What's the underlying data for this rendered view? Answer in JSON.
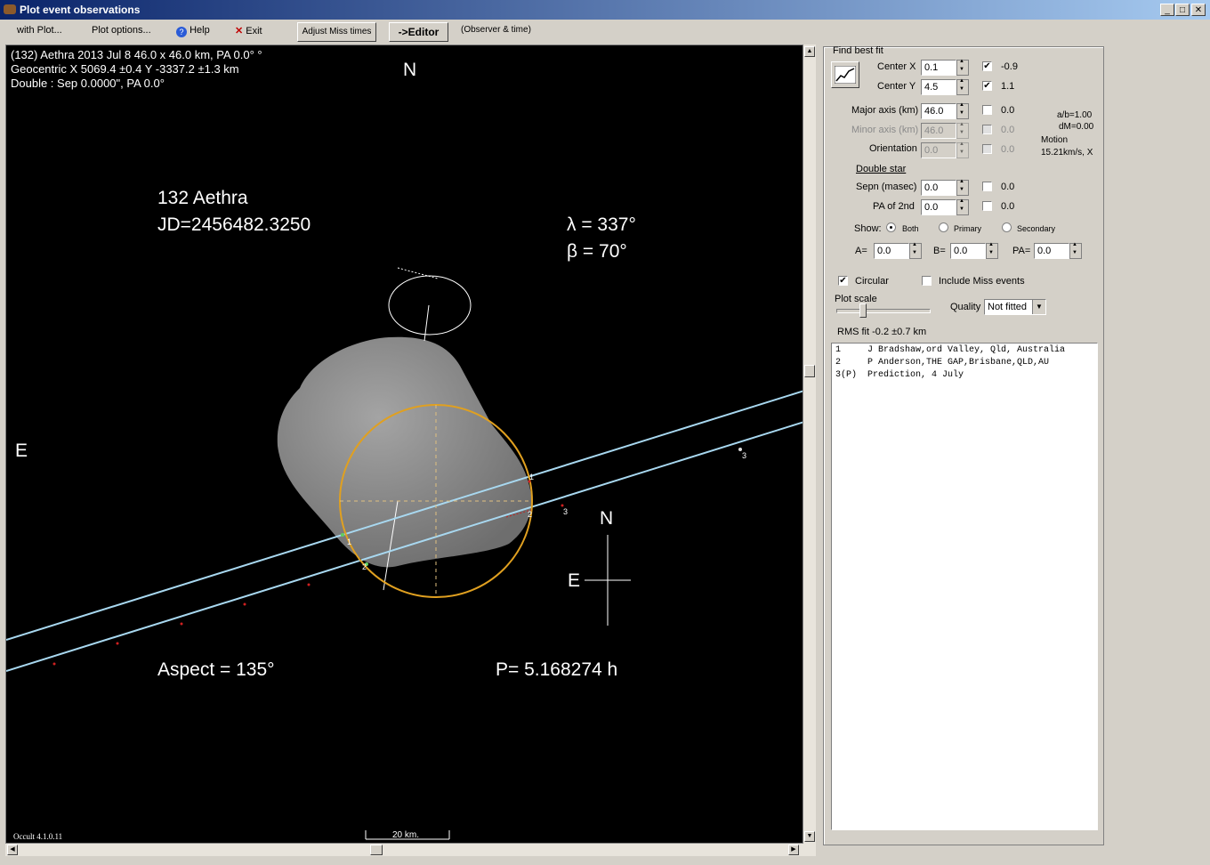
{
  "window": {
    "title": "Plot event observations"
  },
  "menu": {
    "with_plot": "with Plot...",
    "plot_options": "Plot options...",
    "help": "Help",
    "exit": "Exit",
    "adjust_miss_times": "Adjust Miss times",
    "editor": "->Editor",
    "observer_time": "(Observer & time)"
  },
  "plot": {
    "header_line1": "(132) Aethra  2013 Jul 8   46.0 x 46.0 km, PA 0.0° °",
    "header_line2": "Geocentric X  5069.4 ±0.4  Y -3337.2 ±1.3 km",
    "header_line3": "Double : Sep  0.0000\", PA 0.0°",
    "north_label": "N",
    "east_label": "E",
    "asteroid_name": "132 Aethra",
    "jd": "JD=2456482.3250",
    "lambda": "λ =  337°",
    "beta": "β =   70°",
    "aspect": "Aspect = 135°",
    "period": "P= 5.168274 h",
    "compass_north": "N",
    "compass_east": "E",
    "scale_label": "20 km.",
    "version": "Occult 4.1.0.11",
    "chord_labels": [
      "1",
      "2",
      "3",
      "1",
      "2",
      "3"
    ]
  },
  "panel": {
    "find_best_fit": "Find best fit",
    "center_x_label": "Center X",
    "center_x_value": "0.1",
    "center_x_checked": "✔",
    "center_x_result": "-0.9",
    "center_y_label": "Center Y",
    "center_y_value": "4.5",
    "center_y_checked": "✔",
    "center_y_result": "1.1",
    "major_axis_label": "Major axis (km)",
    "major_axis_value": "46.0",
    "major_axis_result": "0.0",
    "minor_axis_label": "Minor axis (km)",
    "minor_axis_value": "46.0",
    "minor_axis_result": "0.0",
    "orientation_label": "Orientation",
    "orientation_value": "0.0",
    "orientation_result": "0.0",
    "ab_ratio": "a/b=1.00",
    "dm": "dM=0.00",
    "motion_label": "Motion",
    "motion_value": "15.21km/s, X",
    "double_star": "Double star",
    "sepn_label": "Sepn (masec)",
    "sepn_value": "0.0",
    "sepn_result": "0.0",
    "pa2_label": "PA of 2nd",
    "pa2_value": "0.0",
    "pa2_result": "0.0",
    "show_label": "Show:",
    "show_both": "Both",
    "show_primary": "Primary",
    "show_secondary": "Secondary",
    "a_label": "A=",
    "a_value": "0.0",
    "b_label": "B=",
    "b_value": "0.0",
    "pa_label": "PA=",
    "pa_value": "0.0",
    "circular_label": "Circular",
    "circular_checked": "✔",
    "include_miss_label": "Include Miss events",
    "plot_scale_label": "Plot scale",
    "quality_label": "Quality",
    "quality_value": "Not fitted",
    "rms_fit": "RMS fit -0.2 ±0.7 km",
    "observations": [
      "1     J Bradshaw,ord Valley, Qld, Australia",
      "2     P Anderson,THE GAP,Brisbane,QLD,AU",
      "3(P)  Prediction, 4 July"
    ]
  },
  "colors": {
    "plot_bg": "#000000",
    "chord": "#a8d8f0",
    "fit_ellipse": "#e0a020",
    "shape_model": "#8c8c8c"
  }
}
